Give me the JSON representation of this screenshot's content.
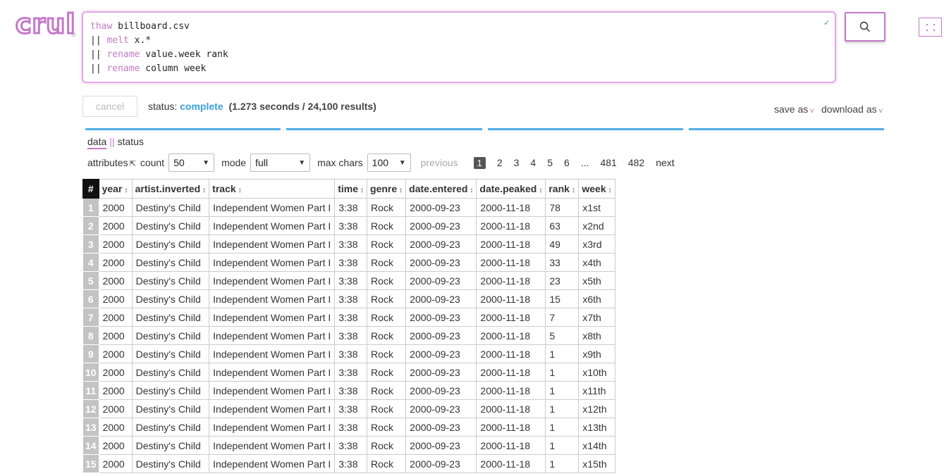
{
  "logo": {
    "text": "crul",
    "reg": "®"
  },
  "query": {
    "lines": [
      {
        "kw": "thaw",
        "rest": " billboard.csv"
      },
      {
        "kw": "|| melt",
        "rest": " x.*"
      },
      {
        "kw": "|| rename",
        "rest": " value.week rank"
      },
      {
        "kw": "|| rename",
        "rest": " column week"
      }
    ],
    "valid_mark": "✓"
  },
  "status": {
    "cancel_label": "cancel",
    "label": "status:",
    "value": "complete",
    "detail": "(1.273 seconds / 24,100 results)"
  },
  "export": {
    "save_as": "save as",
    "download_as": "download as"
  },
  "tabs": {
    "data": "data",
    "sep": "||",
    "status": "status"
  },
  "controls": {
    "attributes": "attributes",
    "count_label": "count",
    "count_value": "50",
    "mode_label": "mode",
    "mode_value": "full",
    "max_chars_label": "max chars",
    "max_chars_value": "100"
  },
  "pager": {
    "previous": "previous",
    "pages": [
      "1",
      "2",
      "3",
      "4",
      "5",
      "6",
      "...",
      "481",
      "482"
    ],
    "current": "1",
    "next": "next"
  },
  "table": {
    "index_header": "#",
    "columns": [
      "year",
      "artist.inverted",
      "track",
      "time",
      "genre",
      "date.entered",
      "date.peaked",
      "rank",
      "week"
    ],
    "rows": [
      [
        "1",
        "2000",
        "Destiny's Child",
        "Independent Women Part I",
        "3:38",
        "Rock",
        "2000-09-23",
        "2000-11-18",
        "78",
        "x1st"
      ],
      [
        "2",
        "2000",
        "Destiny's Child",
        "Independent Women Part I",
        "3:38",
        "Rock",
        "2000-09-23",
        "2000-11-18",
        "63",
        "x2nd"
      ],
      [
        "3",
        "2000",
        "Destiny's Child",
        "Independent Women Part I",
        "3:38",
        "Rock",
        "2000-09-23",
        "2000-11-18",
        "49",
        "x3rd"
      ],
      [
        "4",
        "2000",
        "Destiny's Child",
        "Independent Women Part I",
        "3:38",
        "Rock",
        "2000-09-23",
        "2000-11-18",
        "33",
        "x4th"
      ],
      [
        "5",
        "2000",
        "Destiny's Child",
        "Independent Women Part I",
        "3:38",
        "Rock",
        "2000-09-23",
        "2000-11-18",
        "23",
        "x5th"
      ],
      [
        "6",
        "2000",
        "Destiny's Child",
        "Independent Women Part I",
        "3:38",
        "Rock",
        "2000-09-23",
        "2000-11-18",
        "15",
        "x6th"
      ],
      [
        "7",
        "2000",
        "Destiny's Child",
        "Independent Women Part I",
        "3:38",
        "Rock",
        "2000-09-23",
        "2000-11-18",
        "7",
        "x7th"
      ],
      [
        "8",
        "2000",
        "Destiny's Child",
        "Independent Women Part I",
        "3:38",
        "Rock",
        "2000-09-23",
        "2000-11-18",
        "5",
        "x8th"
      ],
      [
        "9",
        "2000",
        "Destiny's Child",
        "Independent Women Part I",
        "3:38",
        "Rock",
        "2000-09-23",
        "2000-11-18",
        "1",
        "x9th"
      ],
      [
        "10",
        "2000",
        "Destiny's Child",
        "Independent Women Part I",
        "3:38",
        "Rock",
        "2000-09-23",
        "2000-11-18",
        "1",
        "x10th"
      ],
      [
        "11",
        "2000",
        "Destiny's Child",
        "Independent Women Part I",
        "3:38",
        "Rock",
        "2000-09-23",
        "2000-11-18",
        "1",
        "x11th"
      ],
      [
        "12",
        "2000",
        "Destiny's Child",
        "Independent Women Part I",
        "3:38",
        "Rock",
        "2000-09-23",
        "2000-11-18",
        "1",
        "x12th"
      ],
      [
        "13",
        "2000",
        "Destiny's Child",
        "Independent Women Part I",
        "3:38",
        "Rock",
        "2000-09-23",
        "2000-11-18",
        "1",
        "x13th"
      ],
      [
        "14",
        "2000",
        "Destiny's Child",
        "Independent Women Part I",
        "3:38",
        "Rock",
        "2000-09-23",
        "2000-11-18",
        "1",
        "x14th"
      ],
      [
        "15",
        "2000",
        "Destiny's Child",
        "Independent Women Part I",
        "3:38",
        "Rock",
        "2000-09-23",
        "2000-11-18",
        "1",
        "x15th"
      ]
    ]
  },
  "colors": {
    "accent": "#c479c9",
    "status": "#3aa0dc",
    "progress": "#51aee6"
  },
  "icons": {
    "search": "search-icon",
    "grid": "grid-icon",
    "sort": "sort-icon",
    "collapse": "collapse-icon"
  }
}
